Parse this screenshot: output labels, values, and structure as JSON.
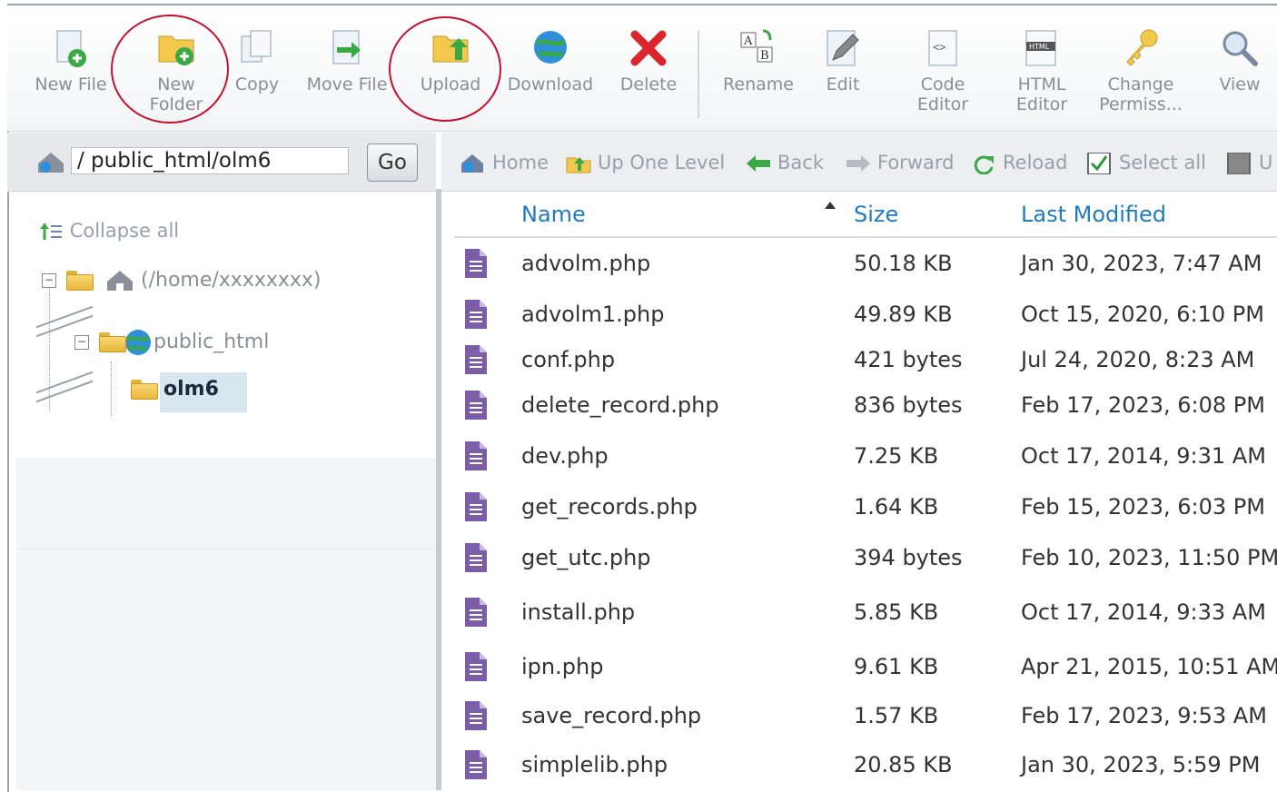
{
  "toolbar": {
    "buttons": [
      {
        "label": "New File"
      },
      {
        "label": "New Folder"
      },
      {
        "label": "Copy"
      },
      {
        "label": "Move File"
      },
      {
        "label": "Upload"
      },
      {
        "label": "Download"
      },
      {
        "label": "Delete"
      },
      {
        "label": "Rename"
      },
      {
        "label": "Edit"
      },
      {
        "label": "Code Editor"
      },
      {
        "label": "HTML Editor"
      },
      {
        "label": "Change Permiss..."
      },
      {
        "label": "View"
      }
    ]
  },
  "pathbar": {
    "path": "/ public_html/olm6",
    "go_label": "Go"
  },
  "navbar": {
    "items": [
      {
        "label": "Home"
      },
      {
        "label": "Up One Level"
      },
      {
        "label": "Back"
      },
      {
        "label": "Forward"
      },
      {
        "label": "Reload"
      },
      {
        "label": "Select all"
      },
      {
        "label": "U"
      }
    ]
  },
  "tree": {
    "collapse_label": "Collapse all",
    "root_label": "(/home/xxxxxxxx)",
    "public_label": "public_html",
    "current_label": "olm6"
  },
  "columns": {
    "name": "Name",
    "size": "Size",
    "modified": "Last Modified"
  },
  "files": [
    {
      "name": "advolm.php",
      "size": "50.18 KB",
      "modified": "Jan 30, 2023, 7:47 AM"
    },
    {
      "name": "advolm1.php",
      "size": "49.89 KB",
      "modified": "Oct 15, 2020, 6:10 PM"
    },
    {
      "name": "conf.php",
      "size": "421 bytes",
      "modified": "Jul 24, 2020, 8:23 AM"
    },
    {
      "name": "delete_record.php",
      "size": "836 bytes",
      "modified": "Feb 17, 2023, 6:08 PM"
    },
    {
      "name": "dev.php",
      "size": "7.25 KB",
      "modified": "Oct 17, 2014, 9:31 AM"
    },
    {
      "name": "get_records.php",
      "size": "1.64 KB",
      "modified": "Feb 15, 2023, 6:03 PM"
    },
    {
      "name": "get_utc.php",
      "size": "394 bytes",
      "modified": "Feb 10, 2023, 11:50 PM"
    },
    {
      "name": "install.php",
      "size": "5.85 KB",
      "modified": "Oct 17, 2014, 9:33 AM"
    },
    {
      "name": "ipn.php",
      "size": "9.61 KB",
      "modified": "Apr 21, 2015, 10:51 AM"
    },
    {
      "name": "save_record.php",
      "size": "1.57 KB",
      "modified": "Feb 17, 2023, 9:53 AM"
    },
    {
      "name": "simplelib.php",
      "size": "20.85 KB",
      "modified": "Jan 30, 2023, 5:59 PM"
    }
  ],
  "colors": {
    "link": "#1f7bbf",
    "file_icon": "#7b5ea7",
    "annotation": "#c8102e"
  }
}
